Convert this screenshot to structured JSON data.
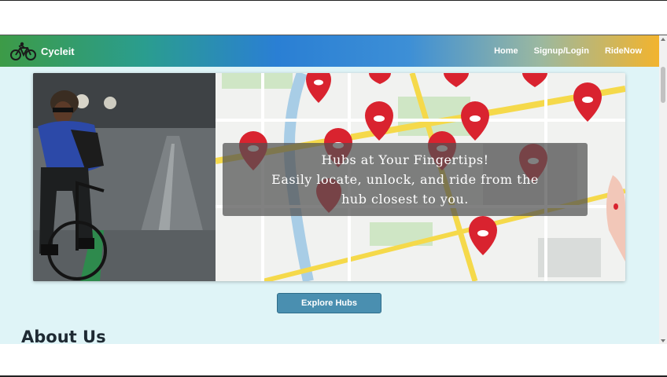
{
  "navbar": {
    "brand": "Cycleit",
    "links": [
      "Home",
      "Signup/Login",
      "RideNow"
    ]
  },
  "hero": {
    "caption_lines": [
      "Hubs at Your Fingertips!",
      "Easily locate, unlock, and ride from the",
      "hub closest to you."
    ]
  },
  "cta": {
    "label": "Explore Hubs"
  },
  "about": {
    "heading": "About Us"
  },
  "colors": {
    "nav_start": "#3d9b47",
    "nav_mid": "#2a7fd4",
    "nav_end": "#f2b42e",
    "page_bg": "#dff4f7",
    "button_bg": "#4a8fb0",
    "pin_red": "#d9232f"
  },
  "icons": {
    "brand": "bicycle-icon",
    "map_pins": "map-pin-icon"
  }
}
